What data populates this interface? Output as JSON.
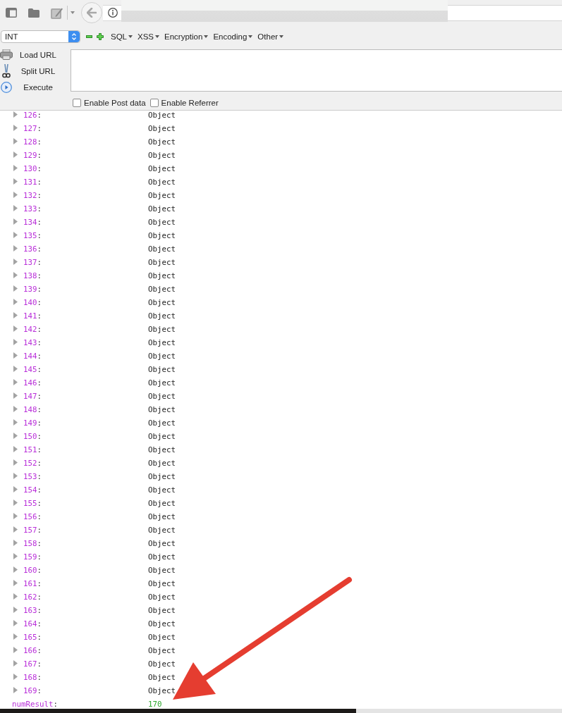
{
  "hackbar": {
    "select": {
      "value": "INT"
    },
    "menus": [
      "SQL",
      "XSS",
      "Encryption",
      "Encoding",
      "Other"
    ],
    "actions": [
      {
        "kind": "load",
        "label": "Load URL"
      },
      {
        "kind": "split",
        "label": "Split URL"
      },
      {
        "kind": "execute",
        "label": "Execute"
      }
    ],
    "options": [
      {
        "label": "Enable Post data",
        "checked": false
      },
      {
        "label": "Enable Referrer",
        "checked": false
      }
    ]
  },
  "result": {
    "rows": [
      {
        "key": "126:",
        "value": "Object",
        "expanded": false
      },
      {
        "key": "127:",
        "value": "Object",
        "expanded": false
      },
      {
        "key": "128:",
        "value": "Object",
        "expanded": false
      },
      {
        "key": "129:",
        "value": "Object",
        "expanded": false
      },
      {
        "key": "130:",
        "value": "Object",
        "expanded": false
      },
      {
        "key": "131:",
        "value": "Object",
        "expanded": false
      },
      {
        "key": "132:",
        "value": "Object",
        "expanded": false
      },
      {
        "key": "133:",
        "value": "Object",
        "expanded": false
      },
      {
        "key": "134:",
        "value": "Object",
        "expanded": false
      },
      {
        "key": "135:",
        "value": "Object",
        "expanded": false
      },
      {
        "key": "136:",
        "value": "Object",
        "expanded": false
      },
      {
        "key": "137:",
        "value": "Object",
        "expanded": false
      },
      {
        "key": "138:",
        "value": "Object",
        "expanded": false
      },
      {
        "key": "139:",
        "value": "Object",
        "expanded": false
      },
      {
        "key": "140:",
        "value": "Object",
        "expanded": false
      },
      {
        "key": "141:",
        "value": "Object",
        "expanded": false
      },
      {
        "key": "142:",
        "value": "Object",
        "expanded": false
      },
      {
        "key": "143:",
        "value": "Object",
        "expanded": false
      },
      {
        "key": "144:",
        "value": "Object",
        "expanded": false
      },
      {
        "key": "145:",
        "value": "Object",
        "expanded": false
      },
      {
        "key": "146:",
        "value": "Object",
        "expanded": false
      },
      {
        "key": "147:",
        "value": "Object",
        "expanded": false
      },
      {
        "key": "148:",
        "value": "Object",
        "expanded": false
      },
      {
        "key": "149:",
        "value": "Object",
        "expanded": false
      },
      {
        "key": "150:",
        "value": "Object",
        "expanded": false
      },
      {
        "key": "151:",
        "value": "Object",
        "expanded": false
      },
      {
        "key": "152:",
        "value": "Object",
        "expanded": false
      },
      {
        "key": "153:",
        "value": "Object",
        "expanded": false
      },
      {
        "key": "154:",
        "value": "Object",
        "expanded": false
      },
      {
        "key": "155:",
        "value": "Object",
        "expanded": false
      },
      {
        "key": "156:",
        "value": "Object",
        "expanded": false
      },
      {
        "key": "157:",
        "value": "Object",
        "expanded": false
      },
      {
        "key": "158:",
        "value": "Object",
        "expanded": false
      },
      {
        "key": "159:",
        "value": "Object",
        "expanded": false
      },
      {
        "key": "160:",
        "value": "Object",
        "expanded": false
      },
      {
        "key": "161:",
        "value": "Object",
        "expanded": false
      },
      {
        "key": "162:",
        "value": "Object",
        "expanded": false
      },
      {
        "key": "163:",
        "value": "Object",
        "expanded": false
      },
      {
        "key": "164:",
        "value": "Object",
        "expanded": false
      },
      {
        "key": "165:",
        "value": "Object",
        "expanded": false
      },
      {
        "key": "166:",
        "value": "Object",
        "expanded": false
      },
      {
        "key": "167:",
        "value": "Object",
        "expanded": false
      },
      {
        "key": "168:",
        "value": "Object",
        "expanded": false
      },
      {
        "key": "169:",
        "value": "Object",
        "expanded": false
      }
    ],
    "total": {
      "key": "numResult:",
      "value": "170"
    }
  }
}
